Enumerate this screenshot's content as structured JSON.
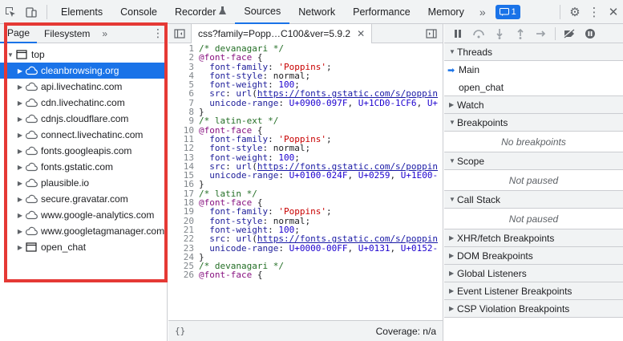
{
  "toolbar": {
    "tabs": [
      "Elements",
      "Console",
      "Recorder",
      "Sources",
      "Network",
      "Performance",
      "Memory"
    ],
    "active_tab": "Sources",
    "more": "»",
    "issues_count": "1"
  },
  "navigator": {
    "tabs": [
      "Page",
      "Filesystem"
    ],
    "more": "»",
    "items": [
      {
        "label": "top",
        "type": "frame"
      },
      {
        "label": "cleanbrowsing.org",
        "type": "cloud",
        "selected": true
      },
      {
        "label": "api.livechatinc.com",
        "type": "cloud"
      },
      {
        "label": "cdn.livechatinc.com",
        "type": "cloud"
      },
      {
        "label": "cdnjs.cloudflare.com",
        "type": "cloud"
      },
      {
        "label": "connect.livechatinc.com",
        "type": "cloud"
      },
      {
        "label": "fonts.googleapis.com",
        "type": "cloud"
      },
      {
        "label": "fonts.gstatic.com",
        "type": "cloud"
      },
      {
        "label": "plausible.io",
        "type": "cloud"
      },
      {
        "label": "secure.gravatar.com",
        "type": "cloud"
      },
      {
        "label": "www.google-analytics.com",
        "type": "cloud"
      },
      {
        "label": "www.googletagmanager.com",
        "type": "cloud"
      },
      {
        "label": "open_chat",
        "type": "frame"
      }
    ]
  },
  "editor": {
    "file_tab": "css?family=Popp…C100&ver=5.9.2",
    "coverage": "Coverage: n/a",
    "braces": "{}",
    "lines": [
      {
        "n": "1",
        "t": "/* devanagari */"
      },
      {
        "n": "2",
        "t": "@font-face {"
      },
      {
        "n": "3",
        "t": "  font-family: 'Poppins';"
      },
      {
        "n": "4",
        "t": "  font-style: normal;"
      },
      {
        "n": "5",
        "t": "  font-weight: 100;"
      },
      {
        "n": "6",
        "t": "  src: url(https://fonts.gstatic.com/s/poppin"
      },
      {
        "n": "7",
        "t": "  unicode-range: U+0900-097F, U+1CD0-1CF6, U+"
      },
      {
        "n": "8",
        "t": "}"
      },
      {
        "n": "9",
        "t": "/* latin-ext */"
      },
      {
        "n": "10",
        "t": "@font-face {"
      },
      {
        "n": "11",
        "t": "  font-family: 'Poppins';"
      },
      {
        "n": "12",
        "t": "  font-style: normal;"
      },
      {
        "n": "13",
        "t": "  font-weight: 100;"
      },
      {
        "n": "14",
        "t": "  src: url(https://fonts.gstatic.com/s/poppin"
      },
      {
        "n": "15",
        "t": "  unicode-range: U+0100-024F, U+0259, U+1E00-"
      },
      {
        "n": "16",
        "t": "}"
      },
      {
        "n": "17",
        "t": "/* latin */"
      },
      {
        "n": "18",
        "t": "@font-face {"
      },
      {
        "n": "19",
        "t": "  font-family: 'Poppins';"
      },
      {
        "n": "20",
        "t": "  font-style: normal;"
      },
      {
        "n": "21",
        "t": "  font-weight: 100;"
      },
      {
        "n": "22",
        "t": "  src: url(https://fonts.gstatic.com/s/poppin"
      },
      {
        "n": "23",
        "t": "  unicode-range: U+0000-00FF, U+0131, U+0152-"
      },
      {
        "n": "24",
        "t": "}"
      },
      {
        "n": "25",
        "t": "/* devanagari */"
      },
      {
        "n": "26",
        "t": "@font-face {"
      }
    ]
  },
  "debugger": {
    "threads_label": "Threads",
    "threads": [
      "Main",
      "open_chat"
    ],
    "sections": [
      {
        "label": "Watch",
        "empty": ""
      },
      {
        "label": "Breakpoints",
        "empty": "No breakpoints"
      },
      {
        "label": "Scope",
        "empty": "Not paused"
      },
      {
        "label": "Call Stack",
        "empty": "Not paused"
      },
      {
        "label": "XHR/fetch Breakpoints",
        "empty": ""
      },
      {
        "label": "DOM Breakpoints",
        "empty": ""
      },
      {
        "label": "Global Listeners",
        "empty": ""
      },
      {
        "label": "Event Listener Breakpoints",
        "empty": ""
      },
      {
        "label": "CSP Violation Breakpoints",
        "empty": ""
      }
    ]
  },
  "colors": {
    "accent": "#1a73e8",
    "highlight_box": "#e53935"
  }
}
